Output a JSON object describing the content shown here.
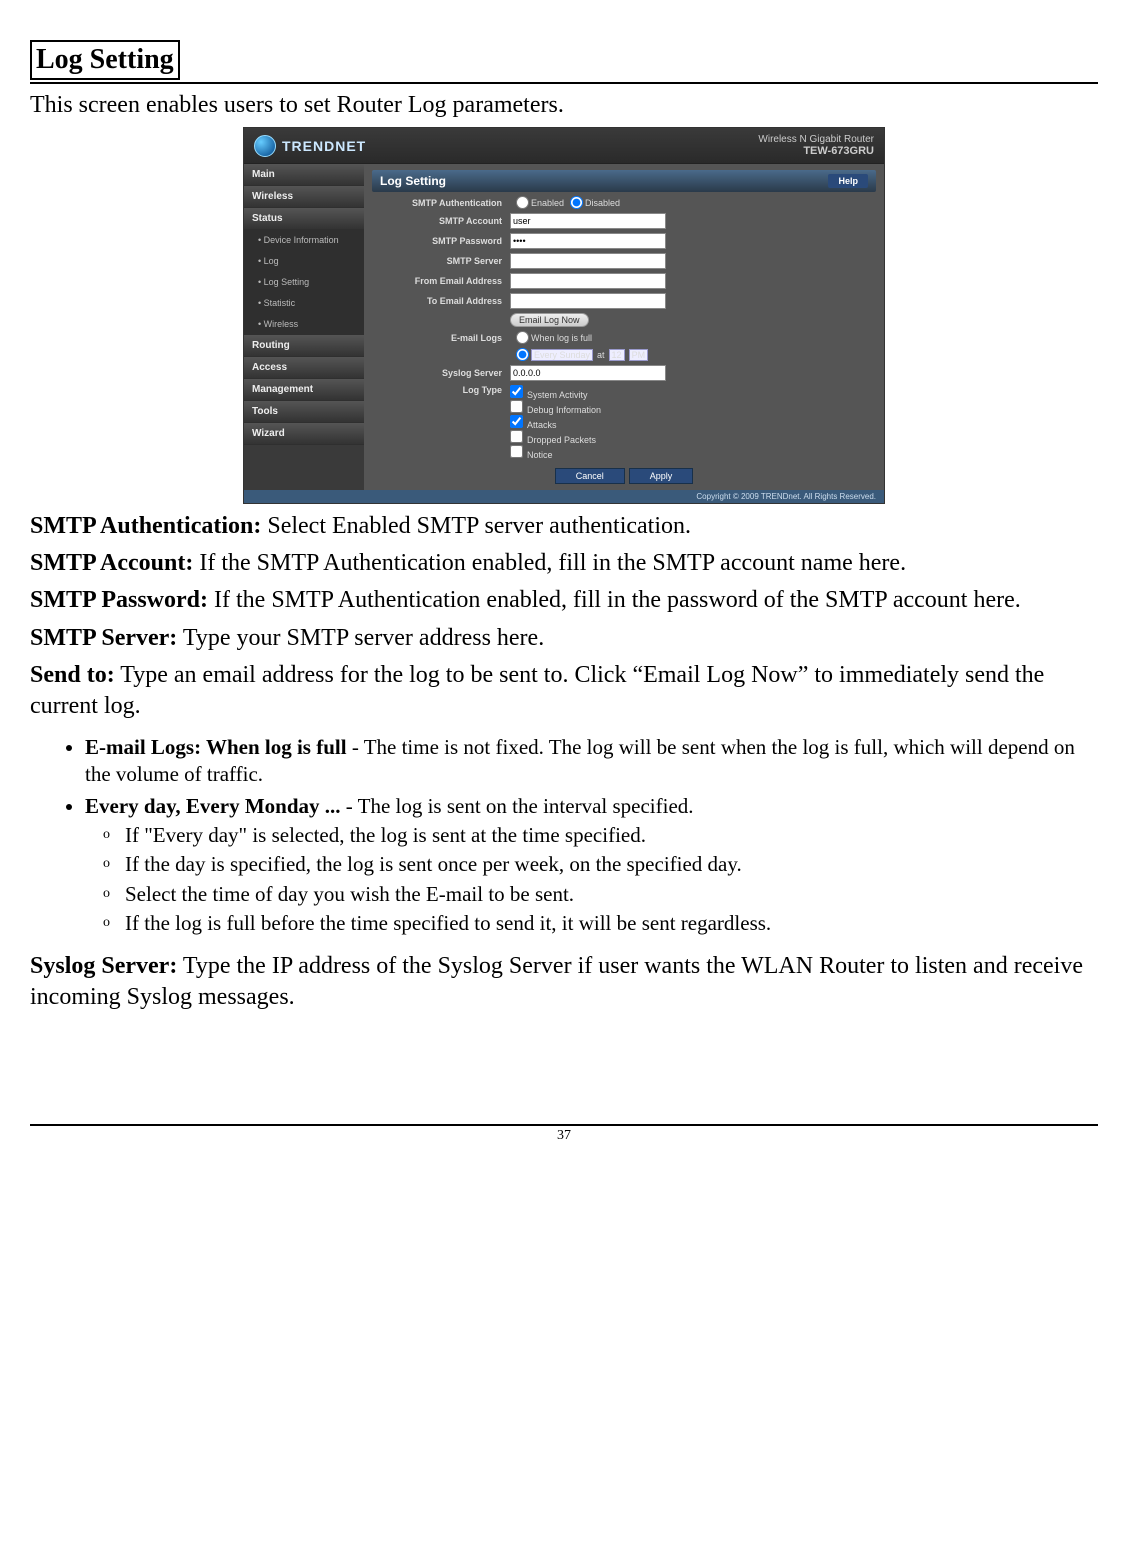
{
  "section_title": "Log Setting",
  "intro": "This screen enables users to set Router Log parameters.",
  "router": {
    "brand": "TRENDNET",
    "model_line1": "Wireless N Gigabit Router",
    "model_line2": "TEW-673GRU",
    "panel_title": "Log Setting",
    "help": "Help",
    "side_tabs": [
      "Main",
      "Wireless",
      "Status"
    ],
    "side_subs": [
      "• Device Information",
      "• Log",
      "• Log Setting",
      "• Statistic",
      "• Wireless"
    ],
    "side_tabs2": [
      "Routing",
      "Access",
      "Management",
      "Tools",
      "Wizard"
    ],
    "labels": {
      "smtp_auth": "SMTP Authentication",
      "enabled": "Enabled",
      "disabled": "Disabled",
      "smtp_account": "SMTP Account",
      "smtp_password": "SMTP Password",
      "smtp_server": "SMTP Server",
      "from_email": "From Email Address",
      "to_email": "To Email Address",
      "email_now": "Email Log Now",
      "email_logs": "E-mail Logs",
      "when_full": "When log is full",
      "schedule_day": "Every Sunday",
      "schedule_at": "at",
      "schedule_hour": "12",
      "schedule_ampm": "PM",
      "syslog": "Syslog Server",
      "log_type": "Log Type",
      "lt1": "System Activity",
      "lt2": "Debug Information",
      "lt3": "Attacks",
      "lt4": "Dropped Packets",
      "lt5": "Notice",
      "cancel": "Cancel",
      "apply": "Apply"
    },
    "values": {
      "account": "user",
      "password": "••••",
      "syslog_ip": "0.0.0.0"
    },
    "copyright": "Copyright © 2009 TRENDnet. All Rights Reserved."
  },
  "defs": {
    "smtp_auth_label": "SMTP Authentication:",
    "smtp_auth_text": " Select Enabled SMTP server authentication.",
    "smtp_account_label": "SMTP Account:",
    "smtp_account_text": " If the SMTP Authentication enabled, fill in the SMTP account name here.",
    "smtp_password_label": "SMTP Password:",
    "smtp_password_text": " If the SMTP Authentication enabled, fill in the password of the SMTP account here.",
    "smtp_server_label": "SMTP Server:",
    "smtp_server_text": " Type your SMTP server address here.",
    "send_to_label": "Send to:",
    "send_to_text": " Type an email address for the log to be sent to. Click “Email Log Now” to immediately send the current log."
  },
  "bullets": {
    "b1_label": "E-mail Logs: When log is full",
    "b1_text": " - The time is not fixed. The log will be sent when the log is full, which will depend on the volume of traffic.",
    "b2_label": "Every day, Every Monday ...",
    "b2_text": "  - The log is sent on the interval specified.",
    "s1": "If \"Every day\" is selected, the log is sent at the time specified.",
    "s2": "If the day is specified, the log is sent once per week, on the specified day.",
    "s3": "Select the time of day you wish the E-mail to be sent.",
    "s4": "If the log is full before the time specified to send it, it will be sent regardless."
  },
  "syslog_label": "Syslog Server:",
  "syslog_text": " Type the IP address of the Syslog Server if user wants the WLAN Router to listen and receive incoming Syslog messages.",
  "page_number": "37"
}
